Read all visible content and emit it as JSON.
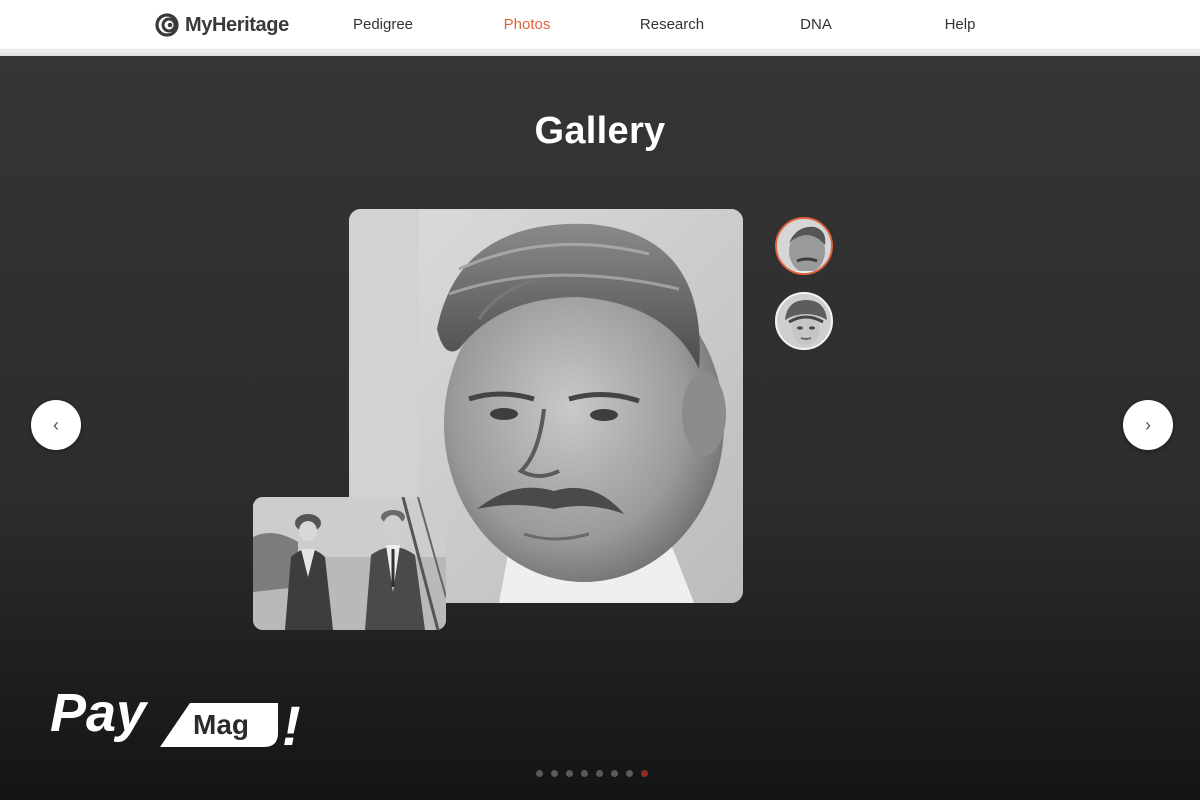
{
  "header": {
    "logo_text": "MyHeritage",
    "nav": [
      {
        "label": "Pedigree",
        "active": false
      },
      {
        "label": "Photos",
        "active": true
      },
      {
        "label": "Research",
        "active": false
      },
      {
        "label": "DNA",
        "active": false
      },
      {
        "label": "Help",
        "active": false
      }
    ]
  },
  "gallery": {
    "title": "Gallery",
    "prev_label": "‹",
    "next_label": "›",
    "thumbnails": [
      {
        "subject": "man-portrait",
        "selected": true
      },
      {
        "subject": "woman-portrait",
        "selected": false
      }
    ],
    "dots_count": 8,
    "active_dot_index": 7
  },
  "watermark": {
    "word_1": "Pay",
    "word_2": "Mag",
    "mark": "!"
  },
  "colors": {
    "accent": "#e0643b",
    "active_dot": "#8a2f22",
    "stage_bg": "#2f2f2f"
  }
}
